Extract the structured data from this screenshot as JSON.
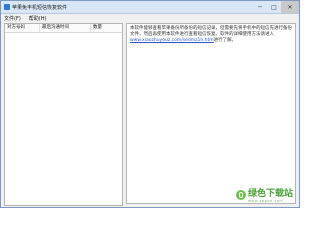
{
  "window": {
    "title": "苹果免丰机短信恢复软件"
  },
  "window_controls": {
    "minimize": "─",
    "maximize": "□",
    "close": "✕"
  },
  "menu": [
    "文件(F)",
    "帮助(H)"
  ],
  "table": {
    "headers": [
      "对方号码",
      "最后沟通时间",
      "数量"
    ]
  },
  "text_pane": {
    "content_pre": "本软件能够查看苹果备份所备份的短信记录，但需要先将手机中的短信先进行备份文件，然后再使用本软件进行查看短信恢复。软件的详细使用方法请进入",
    "link": "www.xiaozhuyouz.com/sedmz1h.htm",
    "content_post": "进行了解。"
  },
  "watermark": {
    "brand": "绿色下载站",
    "sub": "www.xpgod.com"
  }
}
